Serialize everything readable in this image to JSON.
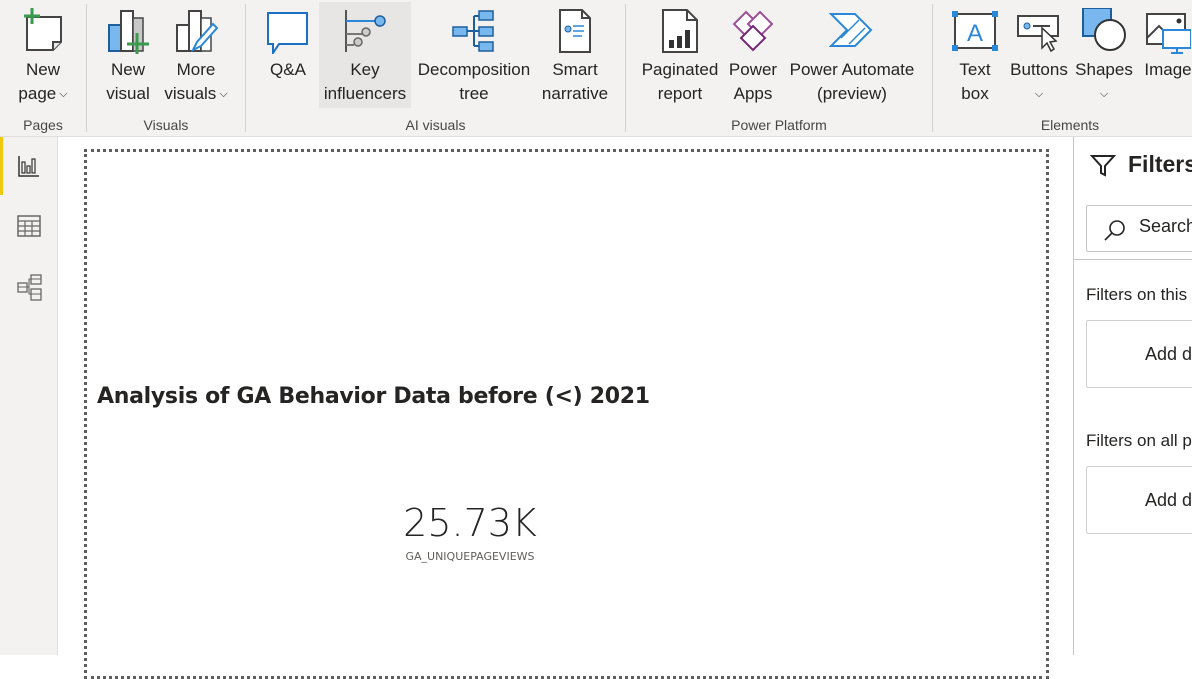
{
  "ribbon": {
    "groups": [
      {
        "label": "Pages",
        "buttons": [
          {
            "label1": "New",
            "label2": "page",
            "dropdown": true,
            "icon": "new-page-icon"
          }
        ]
      },
      {
        "label": "Visuals",
        "buttons": [
          {
            "label1": "New",
            "label2": "visual",
            "dropdown": false,
            "icon": "new-visual-icon"
          },
          {
            "label1": "More",
            "label2": "visuals",
            "dropdown": true,
            "icon": "more-visuals-icon"
          }
        ]
      },
      {
        "label": "AI visuals",
        "buttons": [
          {
            "label1": "Q&A",
            "label2": "",
            "icon": "qa-icon"
          },
          {
            "label1": "Key",
            "label2": "influencers",
            "icon": "key-influencers-icon"
          },
          {
            "label1": "Decomposition",
            "label2": "tree",
            "icon": "decomposition-tree-icon"
          },
          {
            "label1": "Smart",
            "label2": "narrative",
            "icon": "smart-narrative-icon"
          }
        ]
      },
      {
        "label": "Power Platform",
        "buttons": [
          {
            "label1": "Paginated",
            "label2": "report",
            "icon": "paginated-report-icon"
          },
          {
            "label1": "Power",
            "label2": "Apps",
            "icon": "power-apps-icon"
          },
          {
            "label1": "Power Automate",
            "label2": "(preview)",
            "icon": "power-automate-icon"
          }
        ]
      },
      {
        "label": "Elements",
        "buttons": [
          {
            "label1": "Text",
            "label2": "box",
            "icon": "text-box-icon"
          },
          {
            "label1": "Buttons",
            "label2": "",
            "dropdown": true,
            "icon": "buttons-icon"
          },
          {
            "label1": "Shapes",
            "label2": "",
            "dropdown": true,
            "icon": "shapes-icon"
          },
          {
            "label1": "Image",
            "label2": "",
            "icon": "image-icon"
          }
        ]
      }
    ],
    "chevron": "⌄"
  },
  "leftnav": {
    "items": [
      {
        "name": "report-view",
        "icon": "bar-chart-icon",
        "active": true
      },
      {
        "name": "data-view",
        "icon": "table-icon",
        "active": false
      },
      {
        "name": "model-view",
        "icon": "model-icon",
        "active": false
      }
    ]
  },
  "canvas": {
    "title": "Analysis of GA Behavior Data before (<) 2021",
    "card": {
      "value": "25.73K",
      "label": "GA_UNIQUEPAGEVIEWS"
    }
  },
  "filters": {
    "title": "Filters",
    "search_placeholder": "Search",
    "sections": [
      {
        "label": "Filters on this page",
        "drop_text": "Add data fields here"
      },
      {
        "label": "Filters on all pages",
        "drop_text": "Add data fields here"
      }
    ]
  },
  "colors": {
    "accent": "#f2c811",
    "icon_blue": "#0078d4",
    "power_apps": "#742774",
    "new_green": "#3a9b4d"
  }
}
